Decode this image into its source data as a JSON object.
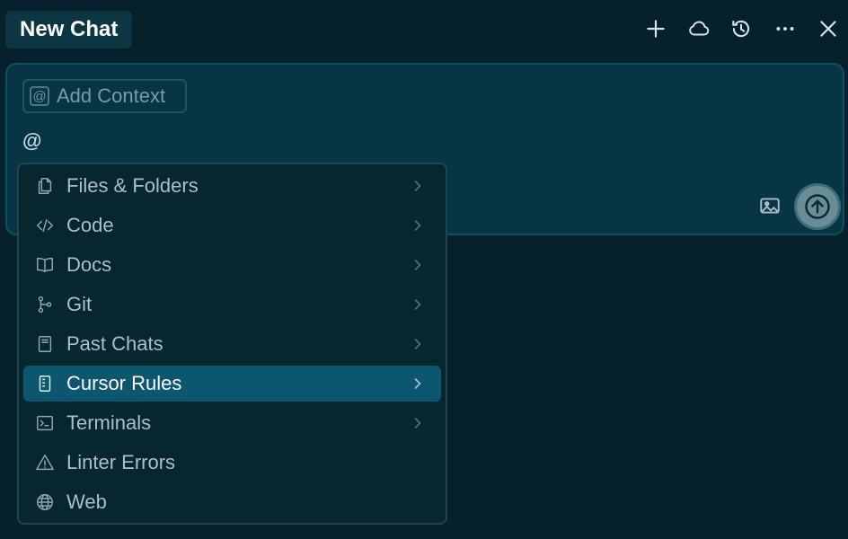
{
  "header": {
    "title": "New Chat",
    "icons": [
      "plus-icon",
      "cloud-icon",
      "history-icon",
      "more-icon",
      "close-icon"
    ]
  },
  "composer": {
    "add_context_label": "Add Context",
    "input_text": "@",
    "image_icon": "image-icon",
    "send_icon": "arrow-up-icon"
  },
  "menu": {
    "items": [
      {
        "label": "Files & Folders",
        "icon": "files-icon",
        "submenu": true
      },
      {
        "label": "Code",
        "icon": "code-icon",
        "submenu": true
      },
      {
        "label": "Docs",
        "icon": "book-icon",
        "submenu": true
      },
      {
        "label": "Git",
        "icon": "git-icon",
        "submenu": true
      },
      {
        "label": "Past Chats",
        "icon": "notebook-icon",
        "submenu": true
      },
      {
        "label": "Cursor Rules",
        "icon": "rules-icon",
        "submenu": true,
        "selected": true
      },
      {
        "label": "Terminals",
        "icon": "terminal-icon",
        "submenu": true
      },
      {
        "label": "Linter Errors",
        "icon": "warning-icon",
        "submenu": false
      },
      {
        "label": "Web",
        "icon": "globe-icon",
        "submenu": false
      }
    ]
  },
  "colors": {
    "background": "#06212b",
    "composer": "#083544",
    "menu_highlight": "#0c5670"
  }
}
